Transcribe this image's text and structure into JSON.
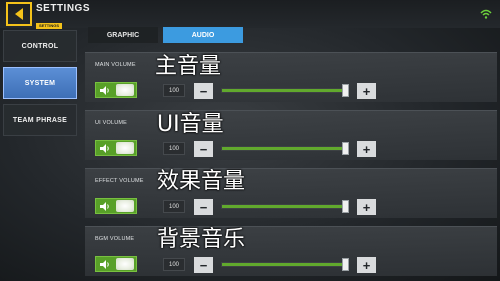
{
  "header": {
    "title": "SETTINGS",
    "badge": "SETTINGS",
    "back_icon": "chevron-left-icon",
    "status_icon": "wifi-icon",
    "accent": "#f4c21a"
  },
  "sidebar": {
    "items": [
      {
        "label": "CONTROL",
        "active": false
      },
      {
        "label": "SYSTEM",
        "active": true
      },
      {
        "label": "TEAM PHRASE",
        "active": false
      }
    ]
  },
  "tabs": [
    {
      "label": "GRAPHIC",
      "active": false
    },
    {
      "label": "AUDIO",
      "active": true
    }
  ],
  "volumes": [
    {
      "label": "MAIN VOLUME",
      "overlay": "主音量",
      "value": "100",
      "level": 1.0
    },
    {
      "label": "UI VOLUME",
      "overlay": "UI音量",
      "value": "100",
      "level": 1.0
    },
    {
      "label": "EFFECT VOLUME",
      "overlay": "效果音量",
      "value": "100",
      "level": 1.0
    },
    {
      "label": "BGM VOLUME",
      "overlay": "背景音乐",
      "value": "100",
      "level": 1.0
    }
  ],
  "controls": {
    "minus": "−",
    "plus": "+",
    "toggle_icon": "speaker-icon"
  },
  "colors": {
    "active_tab": "#3c9be0",
    "active_side": "#4a7fc6",
    "toggle_on": "#58a028",
    "slider_fill": "#61a92d"
  }
}
